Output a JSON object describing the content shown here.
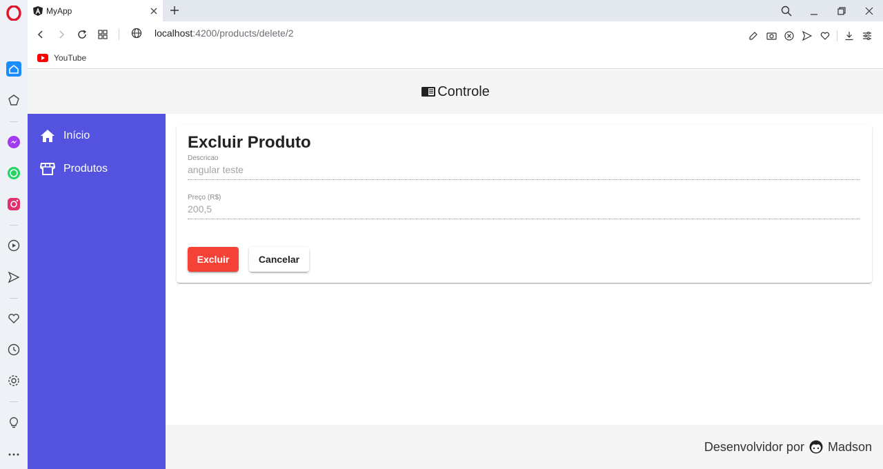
{
  "browser": {
    "tab_title": "MyApp",
    "url_host": "localhost",
    "url_path": ":4200/products/delete/2",
    "bookmark_label": "YouTube"
  },
  "app": {
    "header_title": "Controle",
    "nav": [
      {
        "label": "Início",
        "icon": "home-icon"
      },
      {
        "label": "Produtos",
        "icon": "storefront-icon"
      }
    ],
    "card": {
      "title": "Excluir Produto",
      "fields": [
        {
          "label": "Descricao",
          "value": "angular teste"
        },
        {
          "label": "Preço (R$)",
          "value": "200,5"
        }
      ],
      "delete_label": "Excluir",
      "cancel_label": "Cancelar"
    },
    "footer": {
      "prefix": "Desenvolvidor por",
      "author": "Madson"
    }
  },
  "colors": {
    "sidenav": "#5353e0",
    "delete_button": "#f44336",
    "header_bg": "#f5f5f5"
  }
}
